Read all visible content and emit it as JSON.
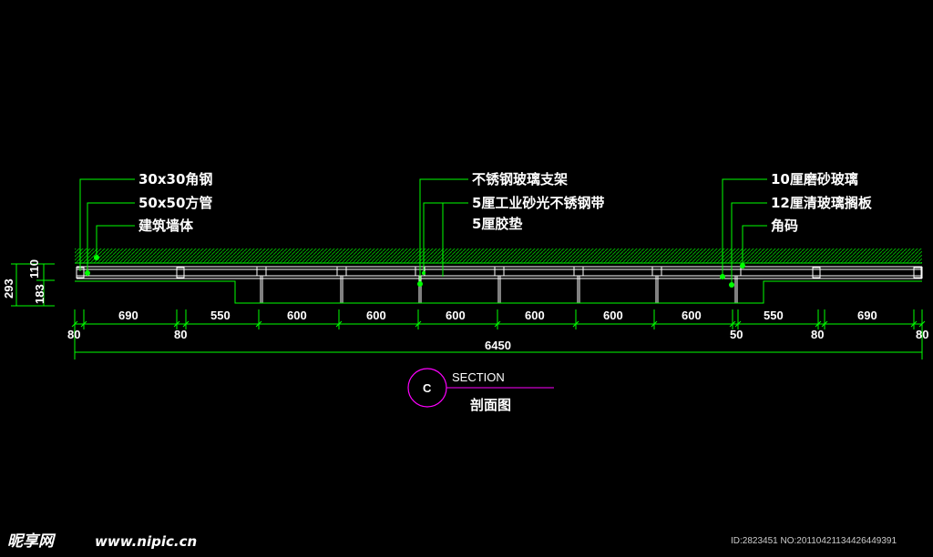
{
  "labels_left": [
    "30x30角钢",
    "50x50方管",
    "建筑墙体"
  ],
  "labels_mid": [
    "不锈钢玻璃支架",
    "5厘工业砂光不锈钢带",
    "5厘胶垫"
  ],
  "labels_right": [
    "10厘磨砂玻璃",
    "12厘清玻璃搁板",
    "角码"
  ],
  "dims_top": [
    "690",
    "550",
    "600",
    "600",
    "600",
    "600",
    "600",
    "600",
    "550",
    "690"
  ],
  "dims_bottom": [
    "80",
    "80",
    "50",
    "80",
    "80"
  ],
  "dim_total": "6450",
  "dims_vertical": {
    "total": "293",
    "upper": "110",
    "lower": "183"
  },
  "section": {
    "marker": "C",
    "title": "SECTION",
    "subtitle": "剖面图"
  },
  "watermark": {
    "logo": "昵享网",
    "url": "www.nipic.cn",
    "id": "ID:2823451 NO:20110421134426449391"
  },
  "colors": {
    "line": "#00ff00",
    "text": "#ffffff",
    "marker": "#ff00ff",
    "background": "#000000"
  }
}
